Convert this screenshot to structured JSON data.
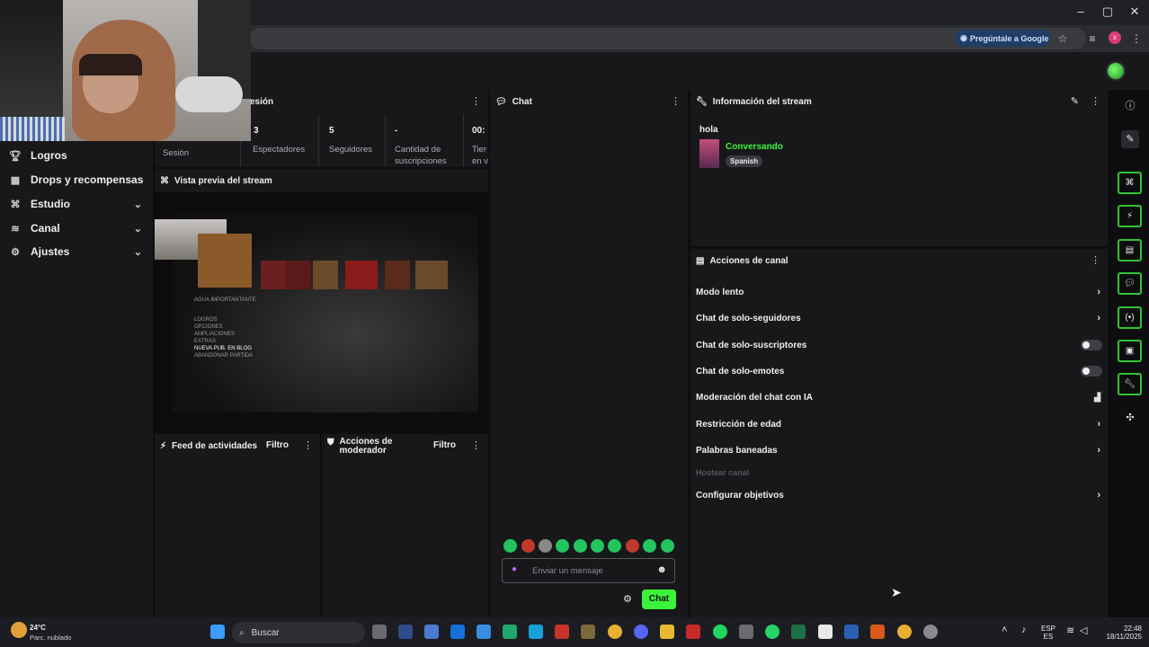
{
  "browser": {
    "ask_google": "Pregúntale a Google",
    "profile_initial": "x"
  },
  "sidebar": {
    "items": [
      {
        "label": "Logros",
        "icon": "trophy-icon",
        "expandable": false
      },
      {
        "label": "Drops y recompensas",
        "icon": "gift-icon",
        "expandable": false
      },
      {
        "label": "Estudio",
        "icon": "studio-icon",
        "expandable": true
      },
      {
        "label": "Canal",
        "icon": "channel-icon",
        "expandable": true
      },
      {
        "label": "Ajustes",
        "icon": "gear-icon",
        "expandable": true
      }
    ]
  },
  "session": {
    "title": "esión",
    "stats": [
      {
        "value": "",
        "label": "Sesión"
      },
      {
        "value": "3",
        "label": "Espectadores"
      },
      {
        "value": "5",
        "label": "Seguidores"
      },
      {
        "value": "-",
        "label": "Cantidad de suscripciones"
      },
      {
        "value": "00:",
        "label": "Tier en v"
      }
    ]
  },
  "preview": {
    "title": "Vista previa del stream",
    "menu_lines": [
      "AGUA IMPORTANTANTE",
      "LOGROS",
      "OPCIONES",
      "AMPLIACIONES",
      "EXTRAS",
      "NUEVA PUB. EN BLOG",
      "ABANDONAR PARTIDA"
    ]
  },
  "activity": {
    "title": "Feed de actividades",
    "filter": "Filtro"
  },
  "mod_actions": {
    "title": "Acciones de moderador",
    "filter": "Filtro"
  },
  "chat": {
    "title": "Chat",
    "placeholder": "Enviar un mensaje",
    "send_label": "Chat"
  },
  "stream_info": {
    "title": "Información del stream",
    "stream_title": "hola",
    "category": "Conversando",
    "tag": "Spanish",
    "accent": "#3cf33c"
  },
  "channel_actions": {
    "title": "Acciones de canal",
    "rows": [
      {
        "label": "Modo lento",
        "control": "chevron"
      },
      {
        "label": "Chat de solo-seguidores",
        "control": "chevron"
      },
      {
        "label": "Chat de solo-suscriptores",
        "control": "toggle"
      },
      {
        "label": "Chat de solo-emotes",
        "control": "toggle"
      },
      {
        "label": "Moderación del chat con IA",
        "control": "chart"
      },
      {
        "label": "Restricción de edad",
        "control": "chevron"
      },
      {
        "label": "Palabras baneadas",
        "control": "chevron"
      },
      {
        "label": "Hostear canal",
        "control": "disabled"
      },
      {
        "label": "Configurar objetivos",
        "control": "chevron"
      }
    ]
  },
  "taskbar": {
    "weather_temp": "24°C",
    "weather_desc": "Parc. nublado",
    "search_label": "Buscar",
    "lang_1": "ESP",
    "lang_2": "ES",
    "time": "22:48",
    "date": "18/11/2025"
  }
}
